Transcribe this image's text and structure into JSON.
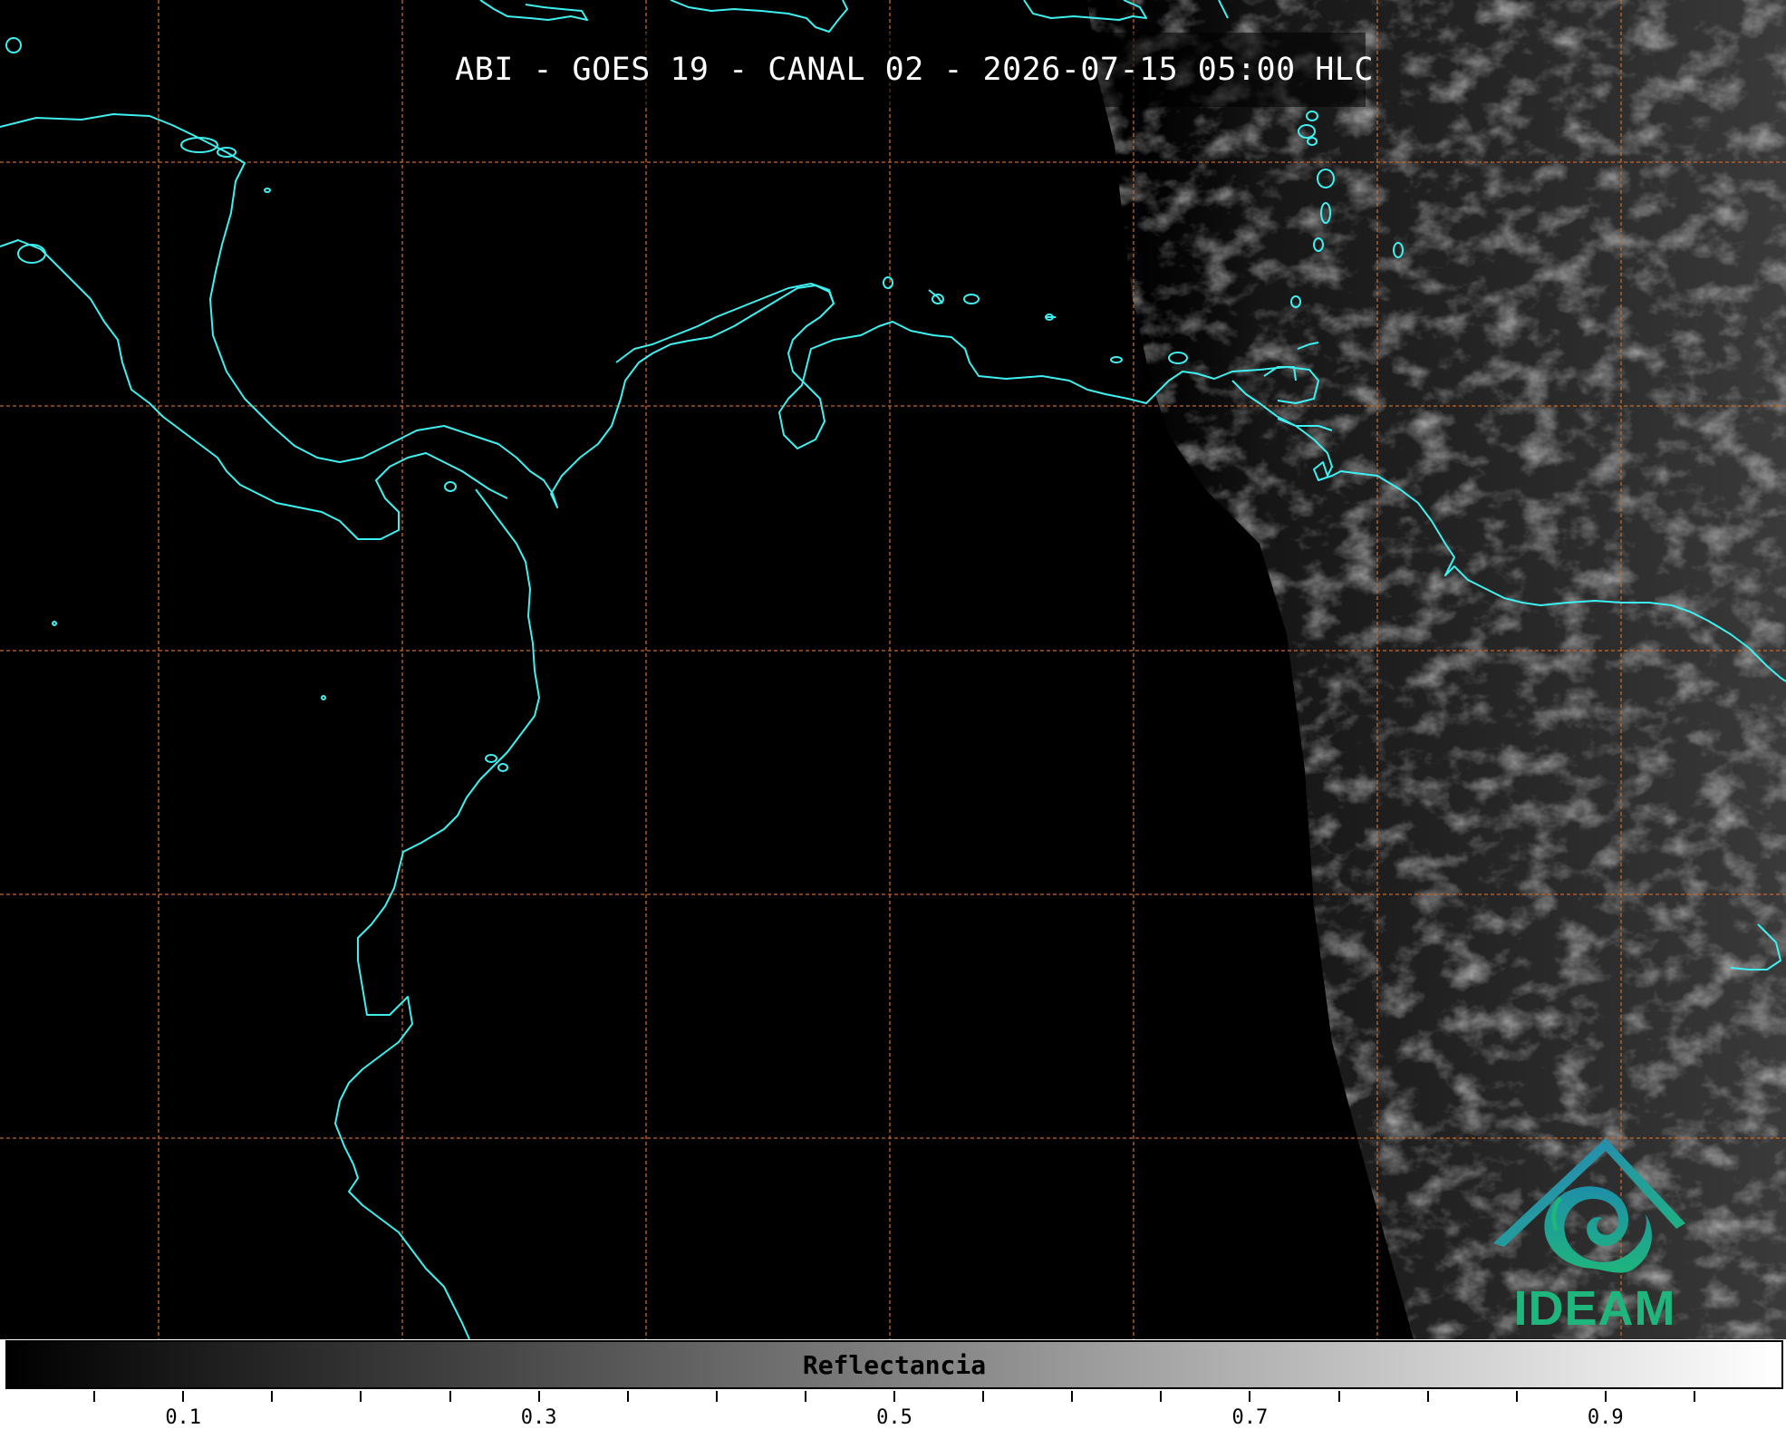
{
  "title": "ABI - GOES 19 - CANAL 02 - 2026-07-15 05:00 HLC",
  "map": {
    "coastline_color": "#3ff0f0",
    "grid_color": "#c8672a",
    "background": "#000000"
  },
  "logo": {
    "text": "IDEAM",
    "color": "#1fb57d",
    "roof_color": "#2a7fc0"
  },
  "colorbar": {
    "label": "Reflectancia",
    "range": [
      0,
      1
    ],
    "tick_labels": [
      "0.1",
      "0.3",
      "0.5",
      "0.7",
      "0.9"
    ],
    "tick_values": [
      0.1,
      0.3,
      0.5,
      0.7,
      0.9
    ]
  }
}
